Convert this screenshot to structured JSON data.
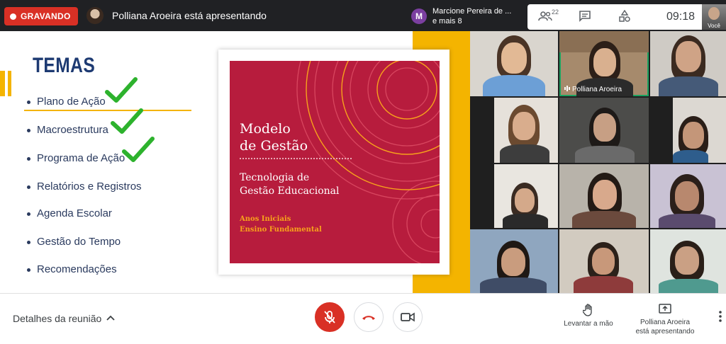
{
  "topbar": {
    "recording_label": "GRAVANDO",
    "presenter_text": "Polliana Aroeira está apresentando",
    "participants_initial": "M",
    "participants_text_line1": "Marcione Pereira de ...",
    "participants_text_line2": "e mais 8",
    "people_count": "22",
    "time": "09:18",
    "self_label": "Você"
  },
  "slide": {
    "heading": "TEMAS",
    "topics": [
      {
        "label": "Plano de Ação",
        "checked": true
      },
      {
        "label": "Macroestrutura",
        "checked": true
      },
      {
        "label": "Programa de Ação",
        "checked": true
      },
      {
        "label": "Relatórios e Registros",
        "checked": false
      },
      {
        "label": "Agenda Escolar",
        "checked": false
      },
      {
        "label": "Gestão do Tempo",
        "checked": false
      },
      {
        "label": "Recomendações",
        "checked": false
      }
    ],
    "cover": {
      "title_line1": "Modelo",
      "title_line2": "de Gestão",
      "subtitle_line1": "Tecnologia de",
      "subtitle_line2": "Gestão Educacional",
      "small_line1": "Anos Iniciais",
      "small_line2": "Ensino Fundamental"
    },
    "colors": {
      "accent": "#f4b400",
      "cover": "#b71c3d",
      "navy": "#1d3a72",
      "check": "#2db22d"
    }
  },
  "grid": {
    "active_speaker_label": "Polliana Aroeira"
  },
  "bottombar": {
    "details_label": "Detalhes da reunião",
    "raise_hand_label": "Levantar a mão",
    "presenting_line1": "Polliana Aroeira",
    "presenting_line2": "está apresentando",
    "icons": [
      "chevron-up-icon",
      "mic-off-icon",
      "hang-up-icon",
      "camera-icon",
      "hand-icon",
      "present-icon",
      "more-vert-icon"
    ]
  }
}
